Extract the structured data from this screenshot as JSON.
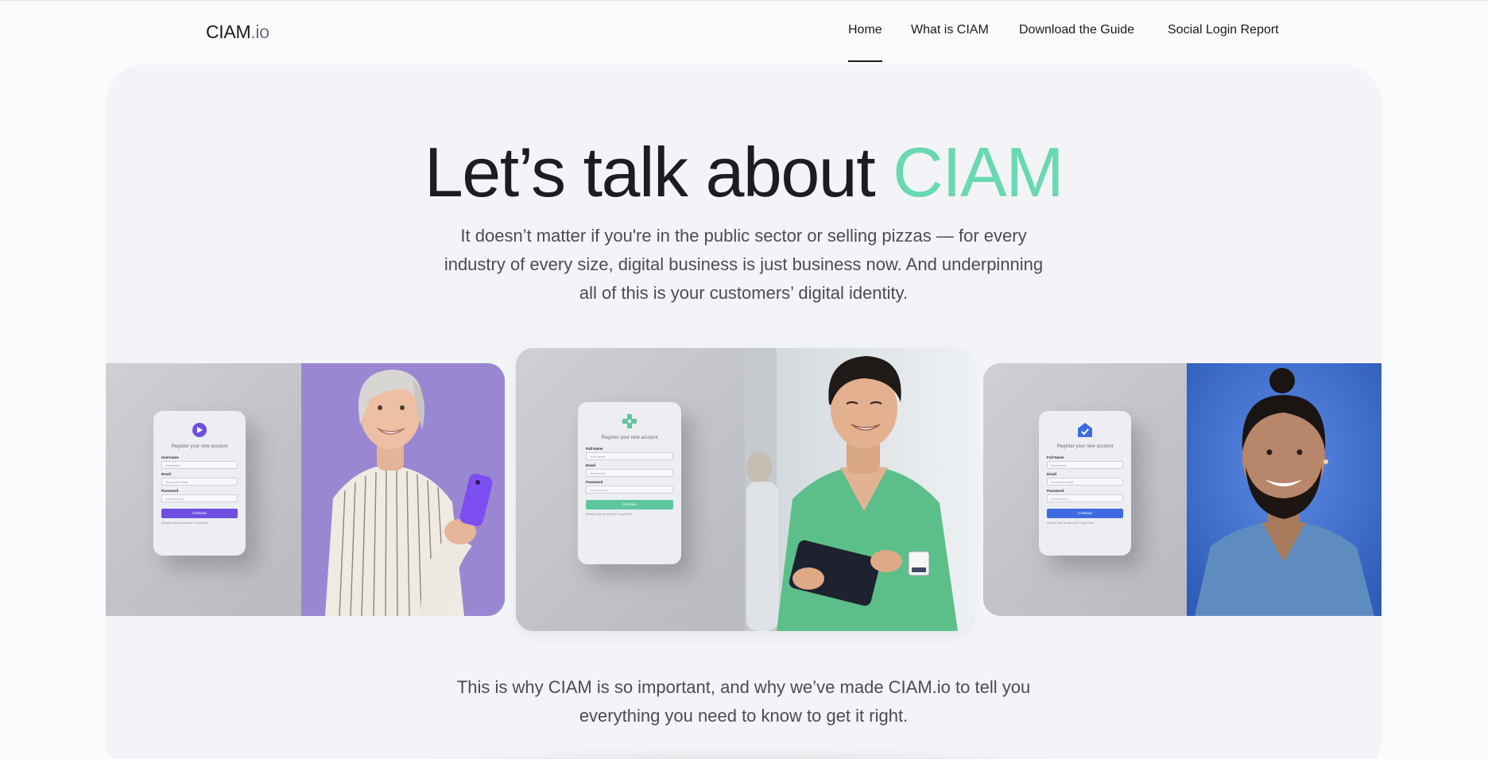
{
  "header": {
    "logo_main": "CIAM",
    "logo_suffix": ".io",
    "nav": [
      {
        "label": "Home",
        "active": true
      },
      {
        "label": "What is CIAM",
        "active": false
      },
      {
        "label": "Download the Guide",
        "active": false
      },
      {
        "label": "Social Login Report",
        "active": false
      }
    ]
  },
  "hero": {
    "headline_plain": "Let’s talk about ",
    "headline_accent": "CIAM",
    "accent_color": "#6ad8b0",
    "lede": "It doesn’t matter if you're in the public sector or selling pizzas — for every industry of every size, digital business is just business now. And underpinning all of this is your customers’ digital identity.",
    "closing": "This is why CIAM is so important, and why we’ve made CIAM.io to tell you everything you need to know to get it right."
  },
  "cards": [
    {
      "brand_color": "#6e4fe0",
      "photo_bg": "#9b86d4",
      "form": {
        "title": "Register your new account",
        "fields": [
          {
            "label": "Username",
            "placeholder": "Username"
          },
          {
            "label": "Email",
            "placeholder": "Your work email"
          },
          {
            "label": "Password",
            "placeholder": "••••••••••••••••"
          }
        ],
        "button": "Continue",
        "footer": "Already have an account? Log in here"
      }
    },
    {
      "brand_color": "#5fc79e",
      "photo_bg": "#dfe3e6",
      "form": {
        "title": "Register your new account",
        "fields": [
          {
            "label": "Full Name",
            "placeholder": "Your name"
          },
          {
            "label": "Email",
            "placeholder": "Your email"
          },
          {
            "label": "Password",
            "placeholder": "••••••••••••••••"
          }
        ],
        "button": "Continue",
        "footer": "Already have an account? Log in here"
      }
    },
    {
      "brand_color": "#3f6be0",
      "photo_bg": "#3d6fd0",
      "form": {
        "title": "Register your new account",
        "fields": [
          {
            "label": "Full Name",
            "placeholder": "Your name"
          },
          {
            "label": "Email",
            "placeholder": "Your work email"
          },
          {
            "label": "Password",
            "placeholder": "••••••••••••••••"
          }
        ],
        "button": "Continue",
        "footer": "Already have an account? Log in here"
      }
    }
  ]
}
